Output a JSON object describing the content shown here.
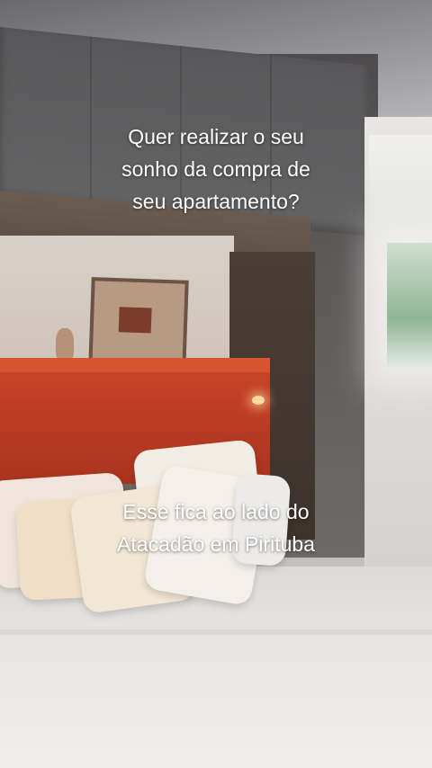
{
  "caption_top": {
    "line1": "Quer realizar o seu",
    "line2": "sonho da compra de",
    "line3": "seu apartamento?"
  },
  "caption_bottom": {
    "line1": "Esse fica ao lado do",
    "line2": "Atacadão em Pirituba"
  },
  "colors": {
    "caption_text": "#ffffff",
    "headboard": "#c9452a"
  }
}
